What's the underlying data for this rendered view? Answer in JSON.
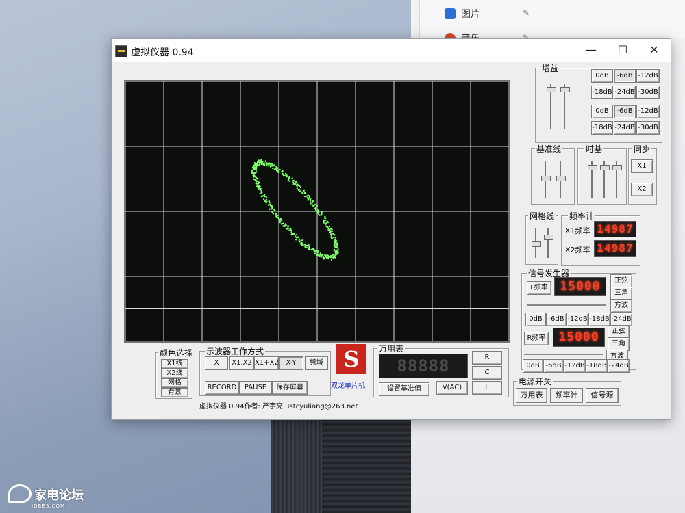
{
  "explorer": {
    "items": [
      {
        "label": "图片",
        "color": "#2b6fd6"
      },
      {
        "label": "音乐",
        "color": "#d64a2b"
      }
    ]
  },
  "watermark": {
    "main": "家电论坛",
    "sub": "JDBBS.COM"
  },
  "window": {
    "title": "虚拟仪器 0.94",
    "minimize": "—",
    "maximize": "☐",
    "close": "✕"
  },
  "gain": {
    "title": "增益",
    "row1": [
      "0dB",
      "-6dB",
      "-12dB"
    ],
    "row2": [
      "-18dB",
      "-24dB",
      "-30dB"
    ],
    "row3": [
      "0dB",
      "-6dB",
      "-12dB"
    ],
    "row4": [
      "-18dB",
      "-24dB",
      "-30dB"
    ],
    "selected": "-6dB"
  },
  "baseline": {
    "title": "基准线"
  },
  "timebase": {
    "title": "时基"
  },
  "sync": {
    "title": "同步",
    "buttons": [
      "X1",
      "X2"
    ]
  },
  "gridline": {
    "title": "网格线"
  },
  "freq": {
    "title": "频率计",
    "x1_label": "X1频率",
    "x1_value": "14987",
    "x2_label": "X2频率",
    "x2_value": "14987"
  },
  "generator": {
    "title": "信号发生器",
    "l_label": "L频率",
    "l_value": "15000",
    "r_label": "R频率",
    "r_value": "15000",
    "waves": [
      "正弦",
      "三角",
      "方波"
    ],
    "l_levels": [
      "0dB",
      "-6dB",
      "-12dB",
      "-18dB",
      "-24dB"
    ],
    "r_levels": [
      "0dB",
      "-6dB",
      "-12dB",
      "-18dB",
      "-24dB"
    ]
  },
  "power": {
    "title": "电源开关",
    "buttons": [
      "万用表",
      "频率计",
      "信号源"
    ]
  },
  "color_select": {
    "title": "颜色选择",
    "buttons": [
      "X1线",
      "X2线",
      "网格",
      "背景"
    ]
  },
  "scope_mode": {
    "title": "示波器工作方式",
    "modes": [
      "X",
      "X1,X2",
      "X1+X2",
      "X-Y",
      "频域"
    ],
    "selected": "X-Y",
    "actions": [
      "RECORD",
      "PAUSE",
      "保存屏幕"
    ]
  },
  "logo": {
    "letter": "S",
    "link": "双龙单片机"
  },
  "meter": {
    "title": "万用表",
    "display": "88888",
    "modes": [
      "R",
      "C",
      "L"
    ],
    "set_baseline": "设置基准值",
    "reading_mode": "V(AC)"
  },
  "footer": "虚拟仪器 0.94作者: 严宇亮  ustcyuliang@263.net",
  "colors": {
    "trace": "#7dff6a",
    "led": "#ff3b20",
    "grid": "#d8d8d8"
  }
}
